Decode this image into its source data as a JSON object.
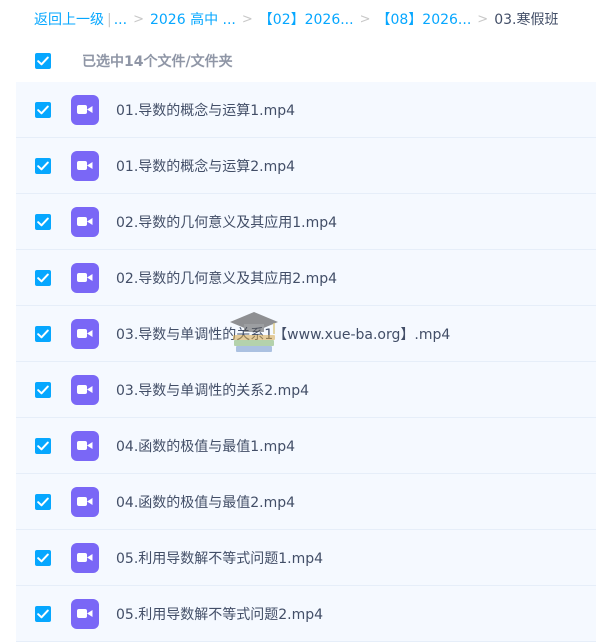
{
  "breadcrumb": {
    "back_label": "返回上一级",
    "pipe": "|",
    "ellipsis": "...",
    "sep": ">",
    "crumbs": [
      "2026 高中 ...",
      "【02】2026...",
      "【08】2026..."
    ],
    "current": "03.寒假班"
  },
  "header": {
    "selected_label": "已选中14个文件/文件夹"
  },
  "files": [
    {
      "name": "01.导数的概念与运算1.mp4",
      "checked": true
    },
    {
      "name": "01.导数的概念与运算2.mp4",
      "checked": true
    },
    {
      "name": "02.导数的几何意义及其应用1.mp4",
      "checked": true
    },
    {
      "name": "02.导数的几何意义及其应用2.mp4",
      "checked": true
    },
    {
      "name": "03.导数与单调性的关系1【www.xue-ba.org】.mp4",
      "checked": true
    },
    {
      "name": "03.导数与单调性的关系2.mp4",
      "checked": true
    },
    {
      "name": "04.函数的极值与最值1.mp4",
      "checked": true
    },
    {
      "name": "04.函数的极值与最值2.mp4",
      "checked": true
    },
    {
      "name": "05.利用导数解不等式问题1.mp4",
      "checked": true
    },
    {
      "name": "05.利用导数解不等式问题2.mp4",
      "checked": true
    }
  ],
  "icons": {
    "checkbox": "check-icon",
    "file": "video-file-icon",
    "watermark": "graduation-cap-books-icon"
  },
  "colors": {
    "accent": "#06a7ff",
    "video_icon": "#7a67f6",
    "row_background": "#f5f9ff",
    "row_divider": "#e6eef9",
    "text": "#424e67",
    "muted": "#8f96a6"
  }
}
